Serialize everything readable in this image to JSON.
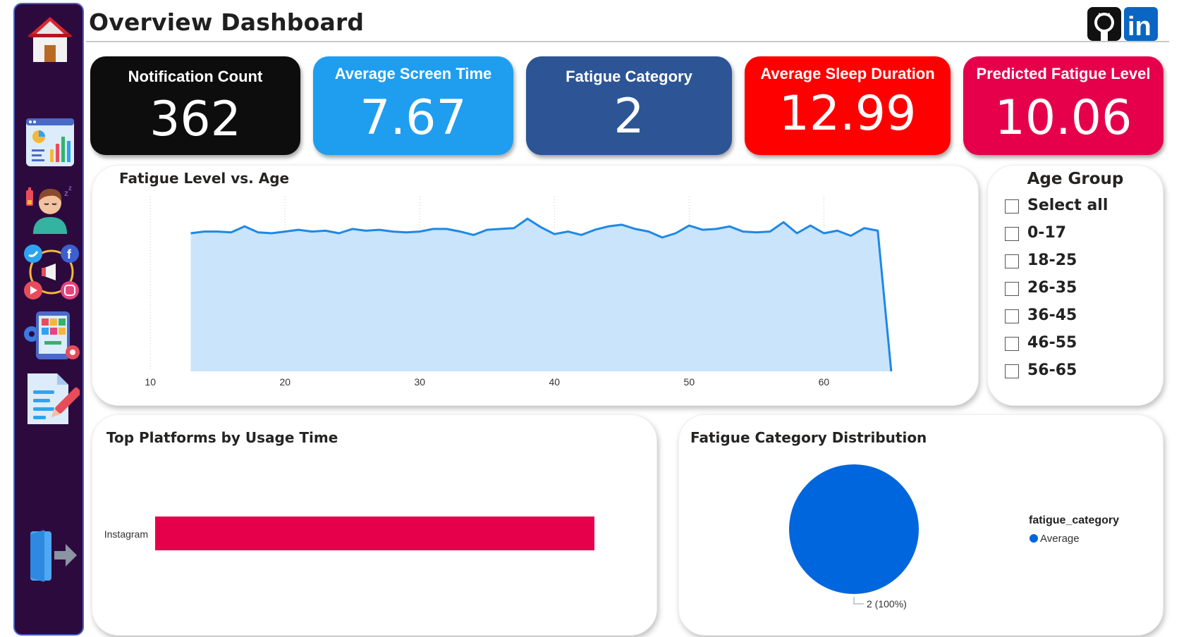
{
  "header": {
    "title": "Overview Dashboard"
  },
  "sidebar": {
    "items": [
      {
        "name": "home-icon"
      },
      {
        "name": "analytics-icon"
      },
      {
        "name": "fatigue-person-icon"
      },
      {
        "name": "social-media-icon"
      },
      {
        "name": "app-settings-icon"
      },
      {
        "name": "report-icon"
      },
      {
        "name": "exit-icon"
      }
    ]
  },
  "social": {
    "github": "github-icon",
    "linkedin": "linkedin-icon",
    "linkedin_text": "in"
  },
  "kpis": [
    {
      "label": "Notification Count",
      "value": "362",
      "color": "#0d0d0d"
    },
    {
      "label": "Average Screen Time",
      "value": "7.67",
      "color": "#1f9ef0"
    },
    {
      "label": "Fatigue Category",
      "value": "2",
      "color": "#2d5595"
    },
    {
      "label": "Average Sleep Duration",
      "value": "12.99",
      "color": "#ff0000"
    },
    {
      "label": "Predicted Fatigue Level",
      "value": "10.06",
      "color": "#e6004c"
    }
  ],
  "slicer": {
    "title": "Age Group",
    "options": [
      "Select all",
      "0-17",
      "18-25",
      "26-35",
      "36-45",
      "46-55",
      "56-65"
    ]
  },
  "chart_data": [
    {
      "type": "area",
      "title": "Fatigue Level vs. Age",
      "xlabel": "",
      "ylabel": "",
      "xlim": [
        8,
        66
      ],
      "ylim": [
        0,
        10
      ],
      "x_ticks": [
        10,
        20,
        30,
        40,
        50,
        60
      ],
      "grid": "vertical dotted",
      "x": [
        13,
        14,
        15,
        16,
        17,
        18,
        19,
        20,
        21,
        22,
        23,
        24,
        25,
        26,
        27,
        28,
        29,
        30,
        31,
        32,
        33,
        34,
        35,
        36,
        37,
        38,
        39,
        40,
        41,
        42,
        43,
        44,
        45,
        46,
        47,
        48,
        49,
        50,
        51,
        52,
        53,
        54,
        55,
        56,
        57,
        58,
        59,
        60,
        61,
        62,
        63,
        64,
        65
      ],
      "y": [
        8.1,
        8.2,
        8.2,
        8.15,
        8.5,
        8.15,
        8.1,
        8.2,
        8.3,
        8.2,
        8.25,
        8.1,
        8.35,
        8.25,
        8.3,
        8.2,
        8.15,
        8.2,
        8.35,
        8.35,
        8.2,
        8.0,
        8.3,
        8.35,
        8.4,
        8.95,
        8.45,
        8.05,
        8.2,
        8.0,
        8.3,
        8.5,
        8.6,
        8.35,
        8.2,
        7.85,
        8.1,
        8.55,
        8.3,
        8.35,
        8.5,
        8.2,
        8.15,
        8.2,
        8.75,
        8.1,
        8.55,
        8.1,
        8.25,
        7.95,
        8.4,
        8.25,
        0.0
      ],
      "color": "#1e88e5",
      "fill": "#c9e4fb"
    },
    {
      "type": "bar",
      "orientation": "horizontal",
      "title": "Top Platforms by Usage Time",
      "categories": [
        "Instagram"
      ],
      "values": [
        100
      ],
      "color": "#e6004c"
    },
    {
      "type": "pie",
      "title": "Fatigue Category Distribution",
      "legend_title": "fatigue_category",
      "legend": [
        {
          "name": "Average",
          "color": "#0066dd"
        }
      ],
      "slices": [
        {
          "label": "2",
          "value": 100,
          "data_label": "2 (100%)",
          "color": "#0066dd"
        }
      ],
      "legend_position": "right"
    }
  ]
}
